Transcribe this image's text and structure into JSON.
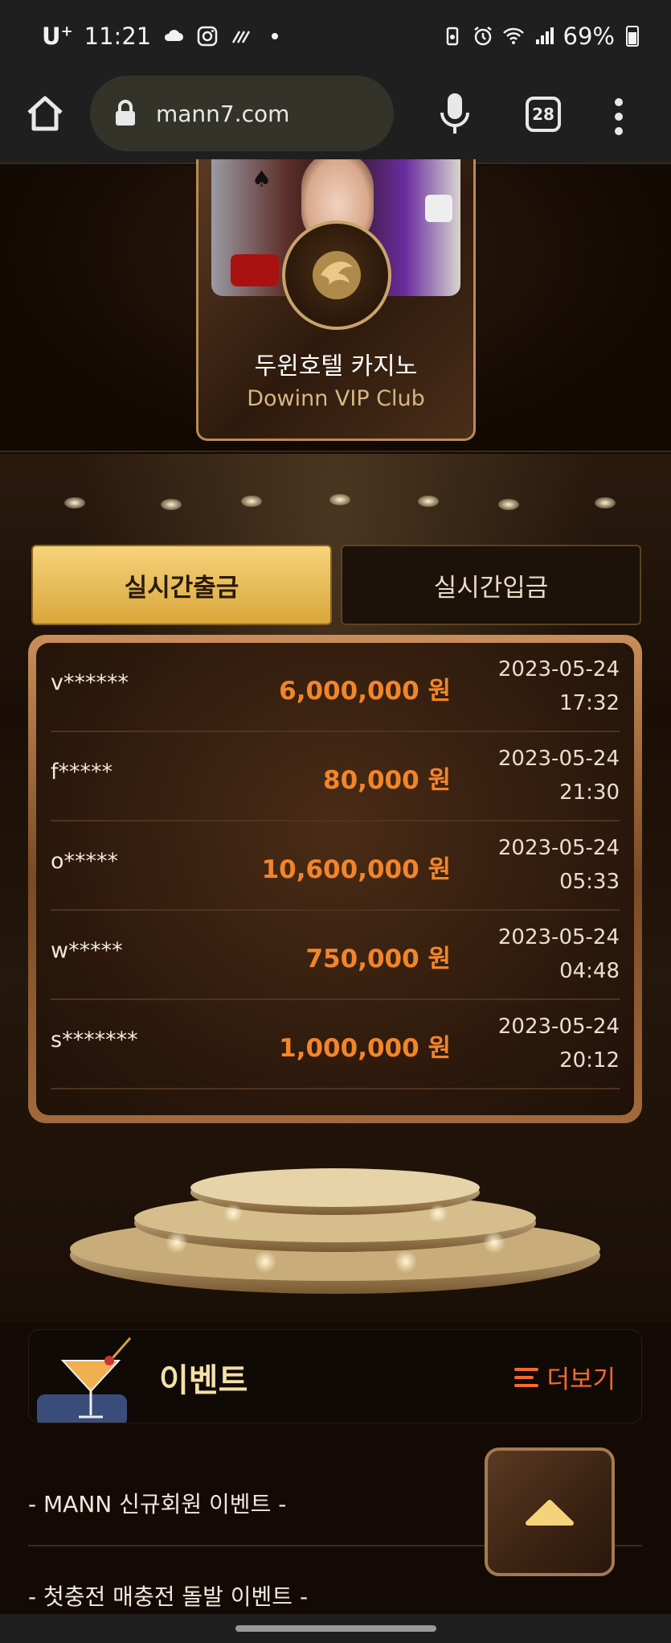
{
  "status_bar": {
    "carrier": "U",
    "carrier_sup": "+",
    "time": "11:21",
    "battery": "69%"
  },
  "browser": {
    "url": "mann7.com",
    "tab_count": "28"
  },
  "casino_card": {
    "title": "두윈호텔 카지노",
    "subtitle": "Dowinn VIP Club"
  },
  "tabs": {
    "withdraw": "실시간출금",
    "deposit": "실시간입금",
    "active": "withdraw"
  },
  "transactions": [
    {
      "user": "v******",
      "amount": "6,000,000 원",
      "date": "2023-05-24",
      "time": "17:32"
    },
    {
      "user": "f*****",
      "amount": "80,000 원",
      "date": "2023-05-24",
      "time": "21:30"
    },
    {
      "user": "o*****",
      "amount": "10,600,000 원",
      "date": "2023-05-24",
      "time": "05:33"
    },
    {
      "user": "w*****",
      "amount": "750,000 원",
      "date": "2023-05-24",
      "time": "04:48"
    },
    {
      "user": "s*******",
      "amount": "1,000,000 원",
      "date": "2023-05-24",
      "time": "20:12"
    }
  ],
  "events": {
    "title": "이벤트",
    "more_label": "더보기",
    "items": [
      "- MANN 신규회원 이벤트 -",
      "- 첫충전 매충전 돌발 이벤트 -"
    ]
  },
  "colors": {
    "accent_gold": "#d9a73c",
    "amount_orange": "#f2852a",
    "more_link": "#f46a2c"
  }
}
